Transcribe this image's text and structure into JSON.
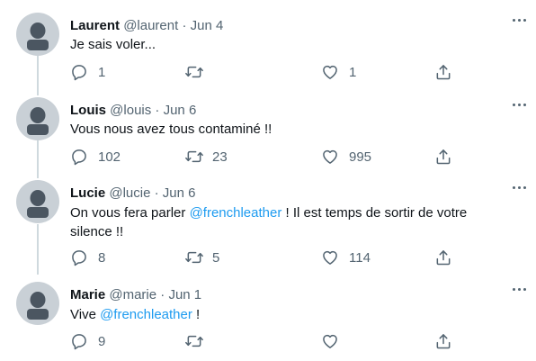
{
  "tweets": [
    {
      "name": "Laurent",
      "handle": "@laurent",
      "separator": "·",
      "date": "Jun 4",
      "text_parts": [
        {
          "text": "Je sais voler...",
          "mention": false
        }
      ],
      "replies": "1",
      "retweets": "",
      "likes": "1"
    },
    {
      "name": "Louis",
      "handle": "@louis",
      "separator": "·",
      "date": "Jun 6",
      "text_parts": [
        {
          "text": "Vous nous avez tous contaminé !!",
          "mention": false
        }
      ],
      "replies": "102",
      "retweets": "23",
      "likes": "995"
    },
    {
      "name": "Lucie",
      "handle": "@lucie",
      "separator": "·",
      "date": "Jun 6",
      "text_parts": [
        {
          "text": "On vous fera parler ",
          "mention": false
        },
        {
          "text": "@frenchleather",
          "mention": true
        },
        {
          "text": " ! Il est temps de sortir de votre silence !!",
          "mention": false
        }
      ],
      "replies": "8",
      "retweets": "5",
      "likes": "114"
    },
    {
      "name": "Marie",
      "handle": "@marie",
      "separator": "·",
      "date": "Jun 1",
      "text_parts": [
        {
          "text": "Vive ",
          "mention": false
        },
        {
          "text": "@frenchleather",
          "mention": true
        },
        {
          "text": " !",
          "mention": false
        }
      ],
      "replies": "9",
      "retweets": "",
      "likes": ""
    }
  ],
  "colors": {
    "mention": "#1d9bf0",
    "meta": "#536471",
    "thread_line": "#cfd9de",
    "avatar": "#c9d0d6"
  },
  "icons": [
    "reply-icon",
    "retweet-icon",
    "like-icon",
    "share-icon",
    "more-icon",
    "avatar-placeholder"
  ]
}
